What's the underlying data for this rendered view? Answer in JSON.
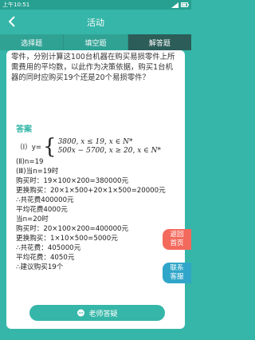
{
  "status": {
    "time": "上午10:51"
  },
  "nav": {
    "title": "活动",
    "back_icon": "chevron-left-icon"
  },
  "tabs": [
    {
      "label": "选择题",
      "active": false
    },
    {
      "label": "填空题",
      "active": false
    },
    {
      "label": "解答题",
      "active": true
    }
  ],
  "question": {
    "text": "零件，分别计算这100台机器在购买易损零件上所需费用的平均数，以此作为决策依据，购买1台机器的同时应购买19个还是20个易损零件？"
  },
  "answer": {
    "heading": "答案",
    "piece": {
      "prefix": "（Ⅰ）y=",
      "case1": "3800, x ≤ 19, x ∈ N*",
      "case2": "500x − 5700, x ≥ 20, x ∈ N*"
    },
    "lines": [
      "(Ⅱ)n=19",
      "(Ⅲ)当n=19时",
      "购买时：19×100×200=380000元",
      "更换购买：20×1×500+20×1×500=20000元",
      "∴共花费400000元",
      "平均花费4000元",
      "当n=20时",
      "购买时：20×100×200=400000元",
      "更换购买：1×10×500=5000元",
      "∴共花费：405000元",
      "平均花费：4050元",
      "∴建议购买19个"
    ]
  },
  "ask_button": {
    "label": "老师答疑"
  },
  "side": {
    "back_top": "返回\n首页",
    "contact": "联系\n客服"
  },
  "colors": {
    "primary": "#35b6a8",
    "active_tab": "#2c5d59",
    "back_top": "#f36a5d",
    "contact": "#2fa6c9"
  }
}
